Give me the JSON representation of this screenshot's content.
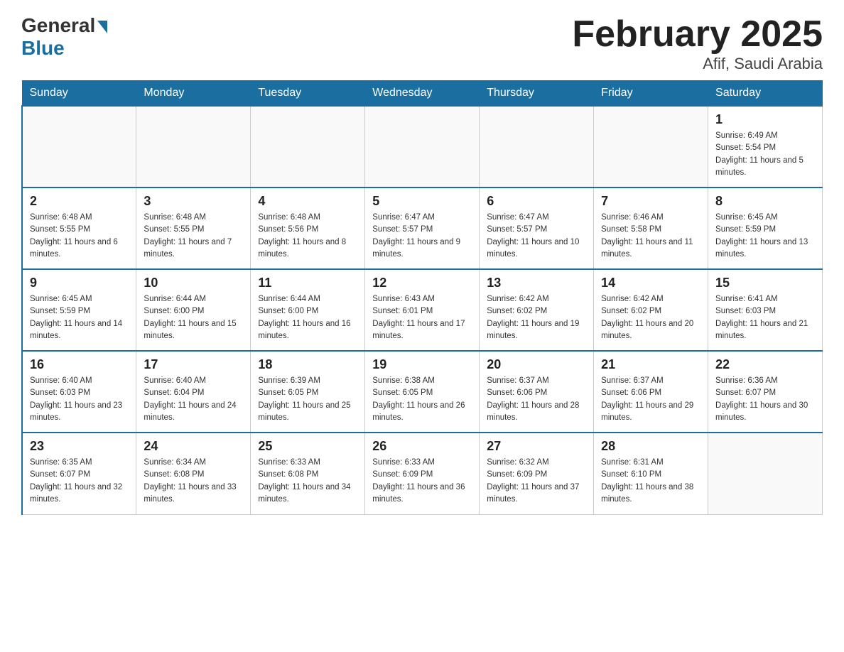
{
  "header": {
    "logo_general": "General",
    "logo_blue": "Blue",
    "month_title": "February 2025",
    "location": "Afif, Saudi Arabia"
  },
  "weekdays": [
    "Sunday",
    "Monday",
    "Tuesday",
    "Wednesday",
    "Thursday",
    "Friday",
    "Saturday"
  ],
  "weeks": [
    [
      {
        "day": "",
        "sunrise": "",
        "sunset": "",
        "daylight": "",
        "empty": true
      },
      {
        "day": "",
        "sunrise": "",
        "sunset": "",
        "daylight": "",
        "empty": true
      },
      {
        "day": "",
        "sunrise": "",
        "sunset": "",
        "daylight": "",
        "empty": true
      },
      {
        "day": "",
        "sunrise": "",
        "sunset": "",
        "daylight": "",
        "empty": true
      },
      {
        "day": "",
        "sunrise": "",
        "sunset": "",
        "daylight": "",
        "empty": true
      },
      {
        "day": "",
        "sunrise": "",
        "sunset": "",
        "daylight": "",
        "empty": true
      },
      {
        "day": "1",
        "sunrise": "Sunrise: 6:49 AM",
        "sunset": "Sunset: 5:54 PM",
        "daylight": "Daylight: 11 hours and 5 minutes.",
        "empty": false
      }
    ],
    [
      {
        "day": "2",
        "sunrise": "Sunrise: 6:48 AM",
        "sunset": "Sunset: 5:55 PM",
        "daylight": "Daylight: 11 hours and 6 minutes.",
        "empty": false
      },
      {
        "day": "3",
        "sunrise": "Sunrise: 6:48 AM",
        "sunset": "Sunset: 5:55 PM",
        "daylight": "Daylight: 11 hours and 7 minutes.",
        "empty": false
      },
      {
        "day": "4",
        "sunrise": "Sunrise: 6:48 AM",
        "sunset": "Sunset: 5:56 PM",
        "daylight": "Daylight: 11 hours and 8 minutes.",
        "empty": false
      },
      {
        "day": "5",
        "sunrise": "Sunrise: 6:47 AM",
        "sunset": "Sunset: 5:57 PM",
        "daylight": "Daylight: 11 hours and 9 minutes.",
        "empty": false
      },
      {
        "day": "6",
        "sunrise": "Sunrise: 6:47 AM",
        "sunset": "Sunset: 5:57 PM",
        "daylight": "Daylight: 11 hours and 10 minutes.",
        "empty": false
      },
      {
        "day": "7",
        "sunrise": "Sunrise: 6:46 AM",
        "sunset": "Sunset: 5:58 PM",
        "daylight": "Daylight: 11 hours and 11 minutes.",
        "empty": false
      },
      {
        "day": "8",
        "sunrise": "Sunrise: 6:45 AM",
        "sunset": "Sunset: 5:59 PM",
        "daylight": "Daylight: 11 hours and 13 minutes.",
        "empty": false
      }
    ],
    [
      {
        "day": "9",
        "sunrise": "Sunrise: 6:45 AM",
        "sunset": "Sunset: 5:59 PM",
        "daylight": "Daylight: 11 hours and 14 minutes.",
        "empty": false
      },
      {
        "day": "10",
        "sunrise": "Sunrise: 6:44 AM",
        "sunset": "Sunset: 6:00 PM",
        "daylight": "Daylight: 11 hours and 15 minutes.",
        "empty": false
      },
      {
        "day": "11",
        "sunrise": "Sunrise: 6:44 AM",
        "sunset": "Sunset: 6:00 PM",
        "daylight": "Daylight: 11 hours and 16 minutes.",
        "empty": false
      },
      {
        "day": "12",
        "sunrise": "Sunrise: 6:43 AM",
        "sunset": "Sunset: 6:01 PM",
        "daylight": "Daylight: 11 hours and 17 minutes.",
        "empty": false
      },
      {
        "day": "13",
        "sunrise": "Sunrise: 6:42 AM",
        "sunset": "Sunset: 6:02 PM",
        "daylight": "Daylight: 11 hours and 19 minutes.",
        "empty": false
      },
      {
        "day": "14",
        "sunrise": "Sunrise: 6:42 AM",
        "sunset": "Sunset: 6:02 PM",
        "daylight": "Daylight: 11 hours and 20 minutes.",
        "empty": false
      },
      {
        "day": "15",
        "sunrise": "Sunrise: 6:41 AM",
        "sunset": "Sunset: 6:03 PM",
        "daylight": "Daylight: 11 hours and 21 minutes.",
        "empty": false
      }
    ],
    [
      {
        "day": "16",
        "sunrise": "Sunrise: 6:40 AM",
        "sunset": "Sunset: 6:03 PM",
        "daylight": "Daylight: 11 hours and 23 minutes.",
        "empty": false
      },
      {
        "day": "17",
        "sunrise": "Sunrise: 6:40 AM",
        "sunset": "Sunset: 6:04 PM",
        "daylight": "Daylight: 11 hours and 24 minutes.",
        "empty": false
      },
      {
        "day": "18",
        "sunrise": "Sunrise: 6:39 AM",
        "sunset": "Sunset: 6:05 PM",
        "daylight": "Daylight: 11 hours and 25 minutes.",
        "empty": false
      },
      {
        "day": "19",
        "sunrise": "Sunrise: 6:38 AM",
        "sunset": "Sunset: 6:05 PM",
        "daylight": "Daylight: 11 hours and 26 minutes.",
        "empty": false
      },
      {
        "day": "20",
        "sunrise": "Sunrise: 6:37 AM",
        "sunset": "Sunset: 6:06 PM",
        "daylight": "Daylight: 11 hours and 28 minutes.",
        "empty": false
      },
      {
        "day": "21",
        "sunrise": "Sunrise: 6:37 AM",
        "sunset": "Sunset: 6:06 PM",
        "daylight": "Daylight: 11 hours and 29 minutes.",
        "empty": false
      },
      {
        "day": "22",
        "sunrise": "Sunrise: 6:36 AM",
        "sunset": "Sunset: 6:07 PM",
        "daylight": "Daylight: 11 hours and 30 minutes.",
        "empty": false
      }
    ],
    [
      {
        "day": "23",
        "sunrise": "Sunrise: 6:35 AM",
        "sunset": "Sunset: 6:07 PM",
        "daylight": "Daylight: 11 hours and 32 minutes.",
        "empty": false
      },
      {
        "day": "24",
        "sunrise": "Sunrise: 6:34 AM",
        "sunset": "Sunset: 6:08 PM",
        "daylight": "Daylight: 11 hours and 33 minutes.",
        "empty": false
      },
      {
        "day": "25",
        "sunrise": "Sunrise: 6:33 AM",
        "sunset": "Sunset: 6:08 PM",
        "daylight": "Daylight: 11 hours and 34 minutes.",
        "empty": false
      },
      {
        "day": "26",
        "sunrise": "Sunrise: 6:33 AM",
        "sunset": "Sunset: 6:09 PM",
        "daylight": "Daylight: 11 hours and 36 minutes.",
        "empty": false
      },
      {
        "day": "27",
        "sunrise": "Sunrise: 6:32 AM",
        "sunset": "Sunset: 6:09 PM",
        "daylight": "Daylight: 11 hours and 37 minutes.",
        "empty": false
      },
      {
        "day": "28",
        "sunrise": "Sunrise: 6:31 AM",
        "sunset": "Sunset: 6:10 PM",
        "daylight": "Daylight: 11 hours and 38 minutes.",
        "empty": false
      },
      {
        "day": "",
        "sunrise": "",
        "sunset": "",
        "daylight": "",
        "empty": true
      }
    ]
  ]
}
